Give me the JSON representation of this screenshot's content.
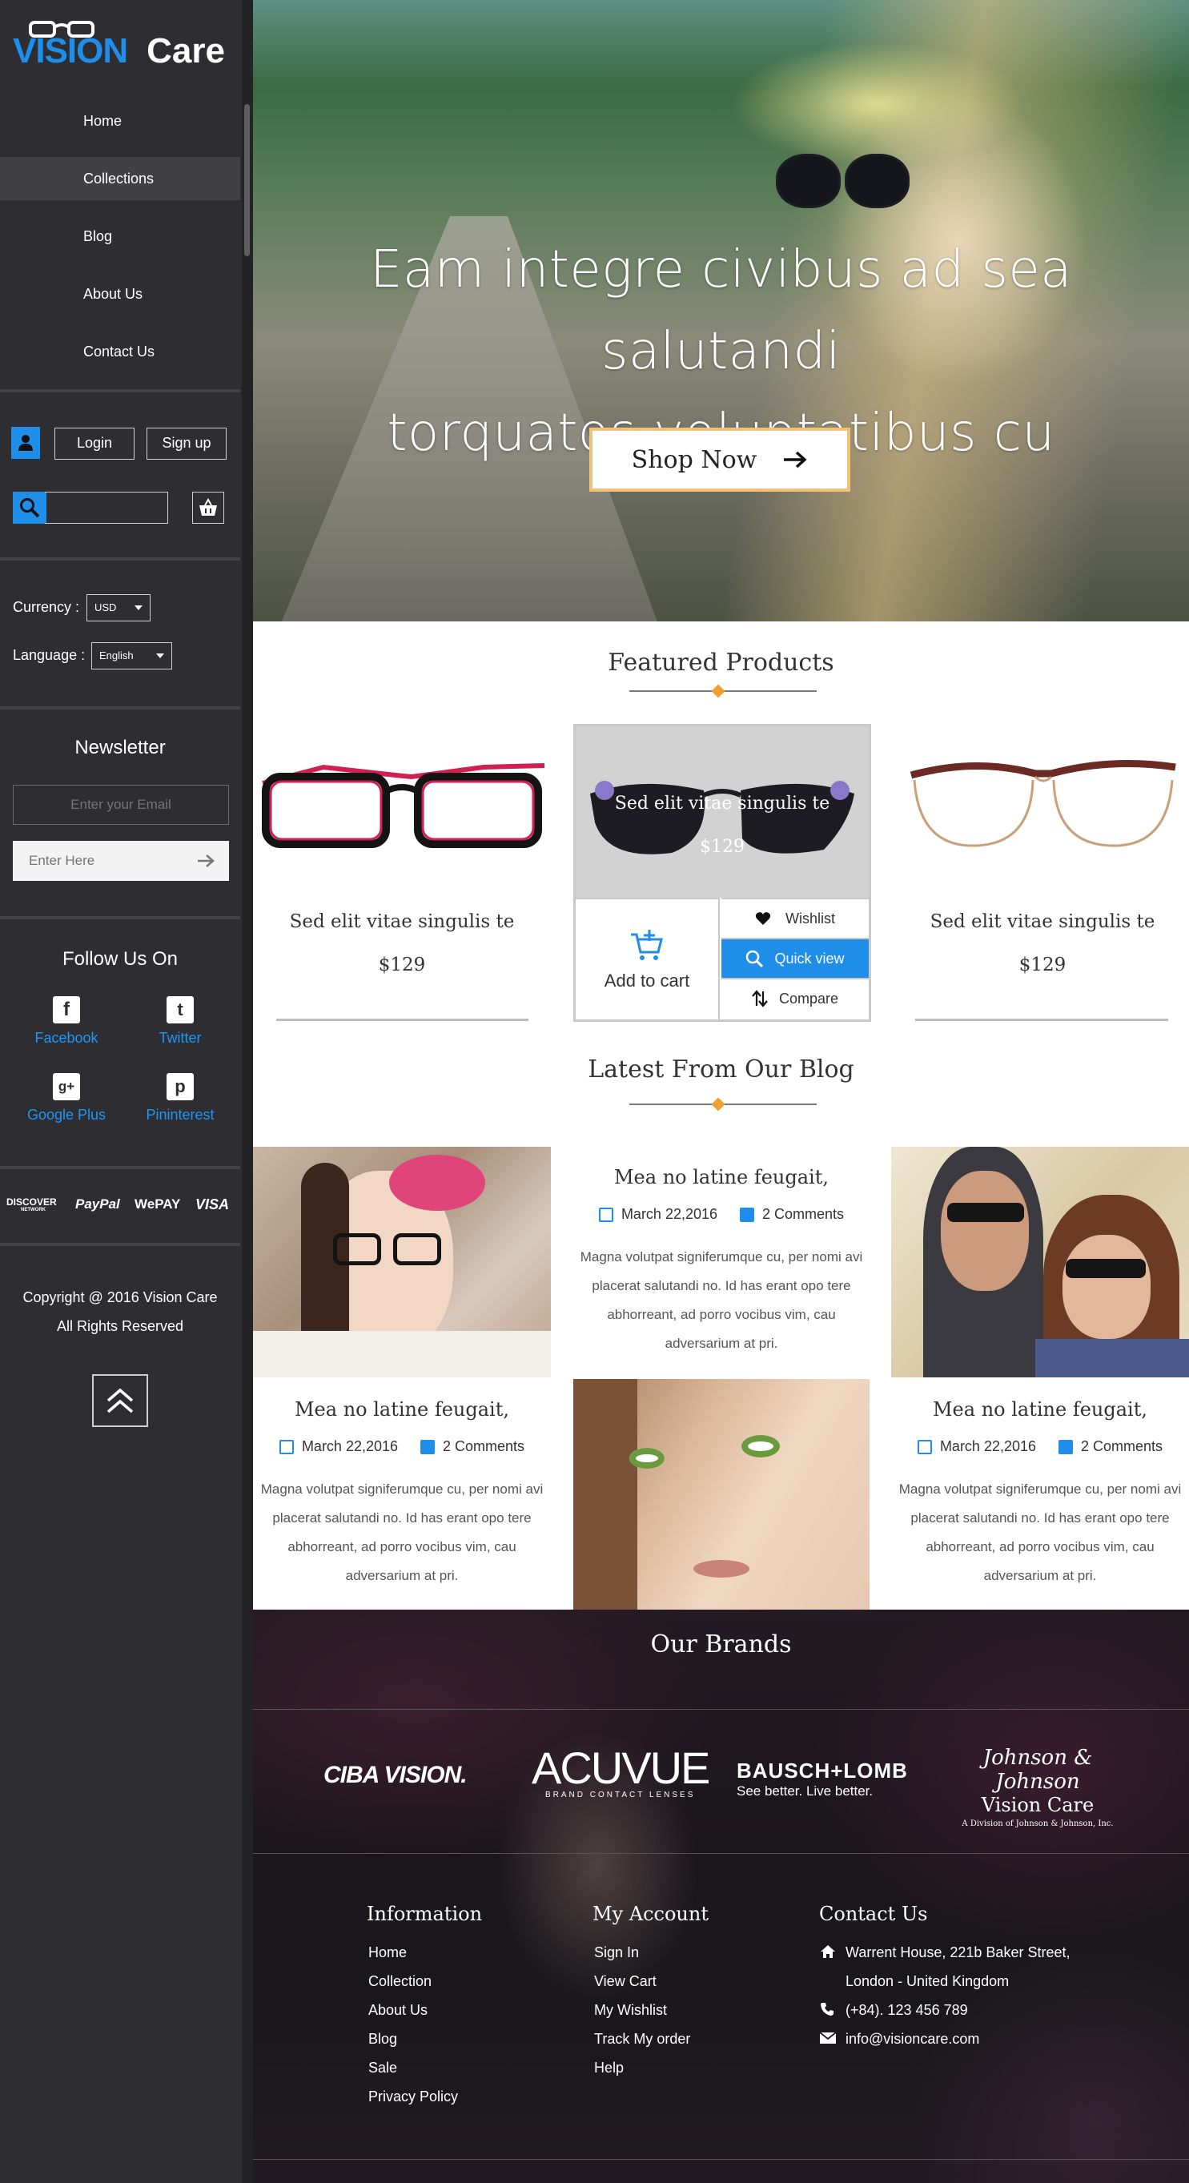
{
  "brand": {
    "logo_part1": "VISION",
    "logo_part2": "Care"
  },
  "nav": [
    {
      "label": "Home"
    },
    {
      "label": "Collections"
    },
    {
      "label": "Blog"
    },
    {
      "label": "About Us"
    },
    {
      "label": "Contact Us"
    }
  ],
  "auth": {
    "login": "Login",
    "signup": "Sign up"
  },
  "search": {
    "value": ""
  },
  "settings": {
    "currency_label": "Currency :",
    "currency_value": "USD",
    "language_label": "Language :",
    "language_value": "English"
  },
  "newsletter": {
    "title": "Newsletter",
    "email_placeholder": "Enter your Email",
    "input_placeholder": "Enter Here"
  },
  "follow": {
    "title": "Follow Us On",
    "links": [
      {
        "label": "Facebook",
        "glyph": "f"
      },
      {
        "label": "Twitter",
        "glyph": "t"
      },
      {
        "label": "Google Plus",
        "glyph": "g+"
      },
      {
        "label": "Pininterest",
        "glyph": "p"
      }
    ]
  },
  "payments": [
    "DISCOVER",
    "PayPal",
    "WePAY",
    "VISA"
  ],
  "payments_sub": "NETWORK",
  "copyright": {
    "line1": "Copyright @ 2016 Vision Care",
    "line2": "All Rights Reserved"
  },
  "hero": {
    "line1": "Eam integre civibus ad sea salutandi",
    "line2": "torquatos voluptatibus cu",
    "cta": "Shop Now"
  },
  "featured": {
    "title": "Featured Products",
    "products": [
      {
        "name": "Sed elit vitae singulis te",
        "price": "$129"
      },
      {
        "name": "Sed elit vitae singulis te",
        "price": "$129"
      },
      {
        "name": "Sed elit vitae singulis te",
        "price": "$129"
      }
    ],
    "actions": {
      "add_to_cart": "Add to cart",
      "wishlist": "Wishlist",
      "quick_view": "Quick view",
      "compare": "Compare"
    }
  },
  "blog": {
    "title": "Latest From Our Blog",
    "posts": [
      {
        "title": "Mea no latine feugait,",
        "date": "March 22,2016",
        "comments": "2 Comments",
        "text": "Magna volutpat signiferumque cu, per nomi avi placerat salutandi no. Id has erant opo tere abhorreant, ad porro vocibus vim, cau adversarium at pri."
      },
      {
        "title": "Mea no latine feugait,",
        "date": "March 22,2016",
        "comments": "2 Comments",
        "text": "Magna volutpat signiferumque cu, per nomi avi placerat salutandi no. Id has erant opo tere abhorreant, ad porro vocibus vim, cau adversarium at pri."
      },
      {
        "title": "Mea no latine feugait,",
        "date": "March 22,2016",
        "comments": "2 Comments",
        "text": "Magna volutpat signiferumque cu, per nomi avi placerat salutandi no. Id has erant opo tere abhorreant, ad porro vocibus vim, cau adversarium at pri."
      }
    ]
  },
  "brands": {
    "title": "Our Brands",
    "ciba": "CIBA VISION.",
    "acuvue": "ACUVUE",
    "acuvue_sub": "BRAND CONTACT LENSES",
    "bausch": "BAUSCH+LOMB",
    "bausch_sub": "See better. Live better.",
    "jj": "Johnson & Johnson",
    "jj_sub": "Vision Care",
    "jj_small": "A Division of Johnson & Johnson, Inc."
  },
  "footer": {
    "information": {
      "title": "Information",
      "links": [
        "Home",
        "Collection",
        "About Us",
        "Blog",
        "Sale",
        "Privacy Policy"
      ]
    },
    "account": {
      "title": "My Account",
      "links": [
        "Sign In",
        "View Cart",
        "My Wishlist",
        "Track My order",
        "Help"
      ]
    },
    "contact": {
      "title": "Contact Us",
      "address1": "Warrent House, 221b Baker Street,",
      "address2": "London - United Kingdom",
      "phone": "(+84). 123 456 789",
      "email": "info@visioncare.com"
    }
  },
  "colors": {
    "accent": "#1e8ee8",
    "sidebar_bg": "#2e2d31",
    "cta_border": "#f3c27a",
    "diamond": "#f0a030"
  },
  "icons": [
    "user-icon",
    "search-icon",
    "basket-icon",
    "arrow-right-icon",
    "facebook-icon",
    "twitter-icon",
    "google-plus-icon",
    "pinterest-icon",
    "chevrons-up-icon",
    "cart-plus-icon",
    "heart-icon",
    "magnifier-icon",
    "compare-icon",
    "edit-icon",
    "comment-icon",
    "home-icon",
    "phone-icon",
    "mail-icon"
  ]
}
